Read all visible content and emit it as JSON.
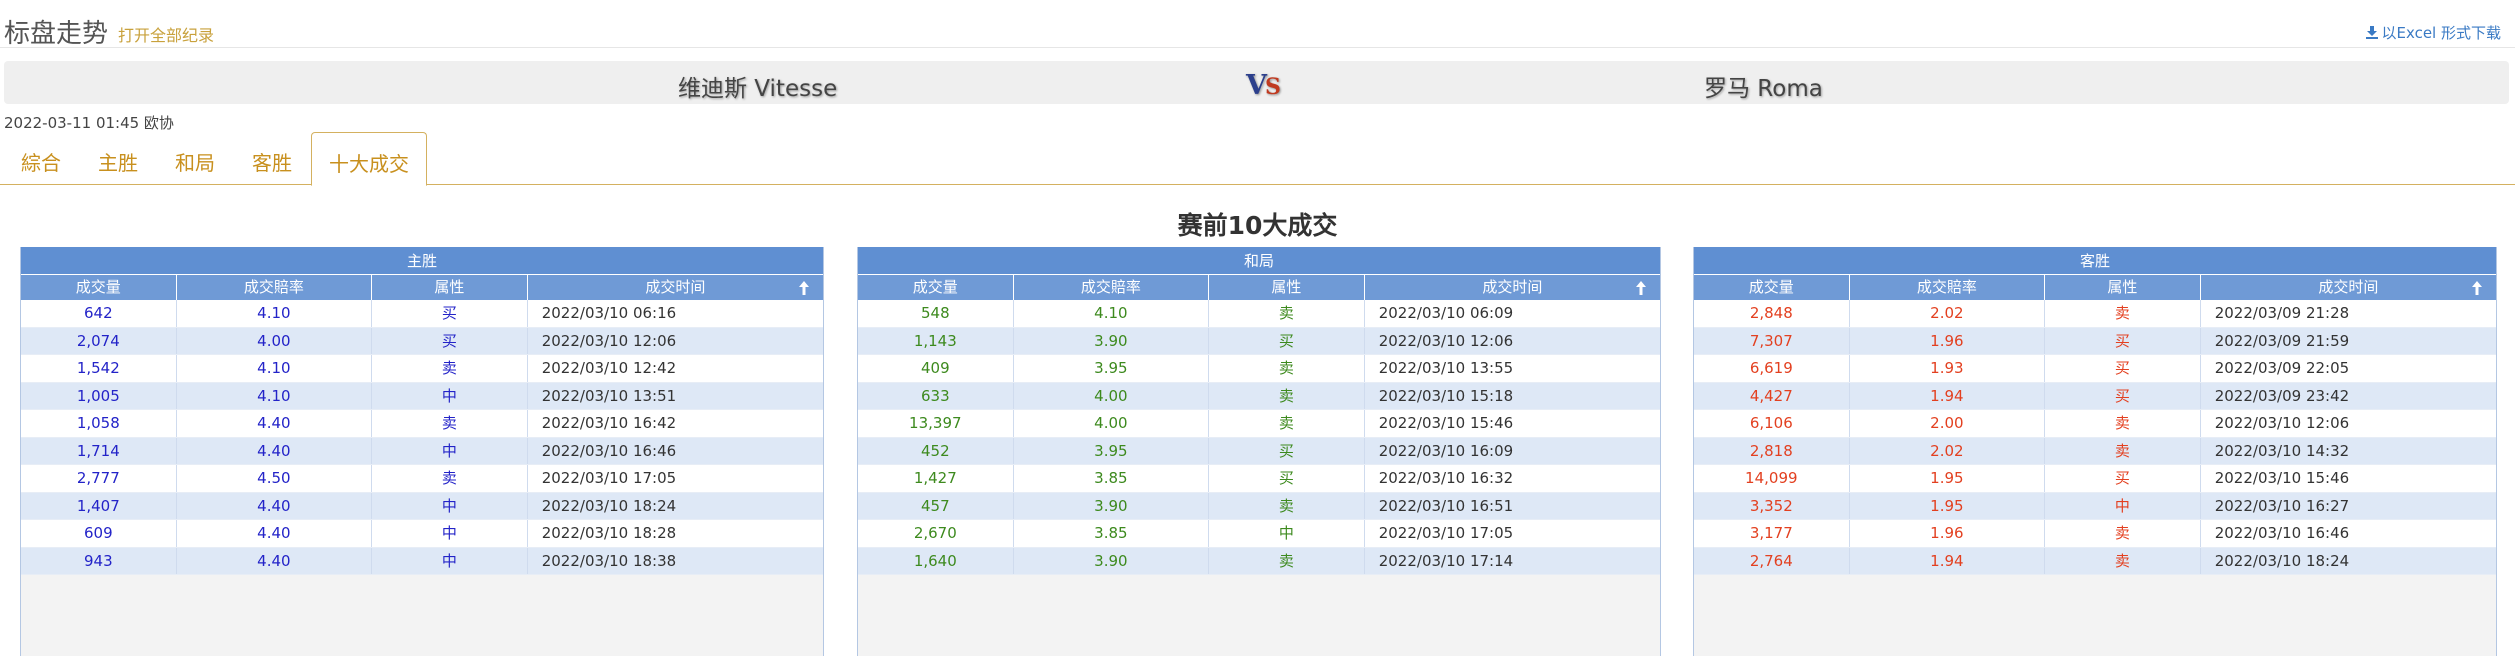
{
  "header": {
    "title": "标盘走势",
    "open_all": "打开全部纪录",
    "excel_link": "以Excel 形式下载"
  },
  "match": {
    "home_team": "维迪斯 Vitesse",
    "vs_v": "V",
    "vs_s": "S",
    "away_team": "罗马 Roma",
    "time_info": "2022-03-11 01:45 欧协"
  },
  "tabs": [
    "綜合",
    "主胜",
    "和局",
    "客胜",
    "十大成交"
  ],
  "active_tab": "十大成交",
  "section_title": "赛前10大成交",
  "columns": [
    "成交量",
    "成交賠率",
    "属性",
    "成交时间"
  ],
  "colors": {
    "home": "#2323c8",
    "draw": "#3d8a1e",
    "away": "#e34020",
    "header_blue": "#5f8fd2",
    "accent_gold": "#c8901e"
  },
  "panels": [
    {
      "title": "主胜",
      "rows": [
        [
          "642",
          "4.10",
          "买",
          "2022/03/10 06:16"
        ],
        [
          "2,074",
          "4.00",
          "买",
          "2022/03/10 12:06"
        ],
        [
          "1,542",
          "4.10",
          "卖",
          "2022/03/10 12:42"
        ],
        [
          "1,005",
          "4.10",
          "中",
          "2022/03/10 13:51"
        ],
        [
          "1,058",
          "4.40",
          "卖",
          "2022/03/10 16:42"
        ],
        [
          "1,714",
          "4.40",
          "中",
          "2022/03/10 16:46"
        ],
        [
          "2,777",
          "4.50",
          "卖",
          "2022/03/10 17:05"
        ],
        [
          "1,407",
          "4.40",
          "中",
          "2022/03/10 18:24"
        ],
        [
          "609",
          "4.40",
          "中",
          "2022/03/10 18:28"
        ],
        [
          "943",
          "4.40",
          "中",
          "2022/03/10 18:38"
        ]
      ]
    },
    {
      "title": "和局",
      "rows": [
        [
          "548",
          "4.10",
          "卖",
          "2022/03/10 06:09"
        ],
        [
          "1,143",
          "3.90",
          "买",
          "2022/03/10 12:06"
        ],
        [
          "409",
          "3.95",
          "卖",
          "2022/03/10 13:55"
        ],
        [
          "633",
          "4.00",
          "卖",
          "2022/03/10 15:18"
        ],
        [
          "13,397",
          "4.00",
          "卖",
          "2022/03/10 15:46"
        ],
        [
          "452",
          "3.95",
          "买",
          "2022/03/10 16:09"
        ],
        [
          "1,427",
          "3.85",
          "买",
          "2022/03/10 16:32"
        ],
        [
          "457",
          "3.90",
          "卖",
          "2022/03/10 16:51"
        ],
        [
          "2,670",
          "3.85",
          "中",
          "2022/03/10 17:05"
        ],
        [
          "1,640",
          "3.90",
          "卖",
          "2022/03/10 17:14"
        ]
      ]
    },
    {
      "title": "客胜",
      "rows": [
        [
          "2,848",
          "2.02",
          "卖",
          "2022/03/09 21:28"
        ],
        [
          "7,307",
          "1.96",
          "买",
          "2022/03/09 21:59"
        ],
        [
          "6,619",
          "1.93",
          "买",
          "2022/03/09 22:05"
        ],
        [
          "4,427",
          "1.94",
          "买",
          "2022/03/09 23:42"
        ],
        [
          "6,106",
          "2.00",
          "卖",
          "2022/03/10 12:06"
        ],
        [
          "2,818",
          "2.02",
          "卖",
          "2022/03/10 14:32"
        ],
        [
          "14,099",
          "1.95",
          "买",
          "2022/03/10 15:46"
        ],
        [
          "3,352",
          "1.95",
          "中",
          "2022/03/10 16:27"
        ],
        [
          "3,177",
          "1.96",
          "卖",
          "2022/03/10 16:46"
        ],
        [
          "2,764",
          "1.94",
          "卖",
          "2022/03/10 18:24"
        ]
      ]
    }
  ]
}
